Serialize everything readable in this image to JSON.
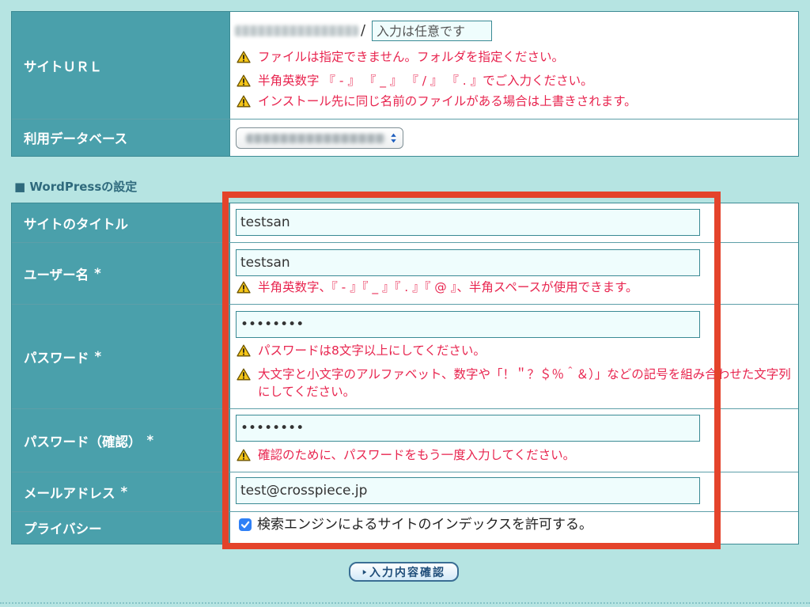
{
  "colors": {
    "page_bg": "#b6e4e2",
    "label_bg": "#4aa0ab",
    "warning_text": "#e8254f",
    "highlight_border": "#e4432b"
  },
  "site_url": {
    "label": "サイトＵＲＬ",
    "separator": "/",
    "subdir_placeholder": "入力は任意です",
    "warnings": [
      "ファイルは指定できません。フォルダを指定ください。",
      "半角英数字 『 - 』 『 _ 』 『 / 』 『 . 』でご入力ください。",
      "インストール先に同じ名前のファイルがある場合は上書きされます。"
    ]
  },
  "database": {
    "label": "利用データベース"
  },
  "wordpress_settings": {
    "heading": "■ WordPressの設定",
    "site_title": {
      "label": "サイトのタイトル",
      "value": "testsan"
    },
    "username": {
      "label": "ユーザー名",
      "required_mark": "*",
      "value": "testsan",
      "warnings": [
        "半角英数字、『 - 』『 _ 』『 . 』『 @ 』、半角スペースが使用できます。"
      ]
    },
    "password": {
      "label": "パスワード",
      "required_mark": "*",
      "value": "••••••••",
      "warnings": [
        "パスワードは8文字以上にしてください。",
        "大文字と小文字のアルファベット、数字や「！＂？＄％＾＆）」などの記号を組み合わせた文字列にしてください。"
      ]
    },
    "password_confirm": {
      "label": "パスワード（確認）",
      "required_mark": "*",
      "value": "••••••••",
      "warnings": [
        "確認のために、パスワードをもう一度入力してください。"
      ]
    },
    "email": {
      "label": "メールアドレス",
      "required_mark": "*",
      "value": "test@crosspiece.jp"
    },
    "privacy": {
      "label": "プライバシー",
      "checkbox_label": "検索エンジンによるサイトのインデックスを許可する。",
      "checked": true
    }
  },
  "confirm_button": {
    "label": "入力内容確認"
  }
}
